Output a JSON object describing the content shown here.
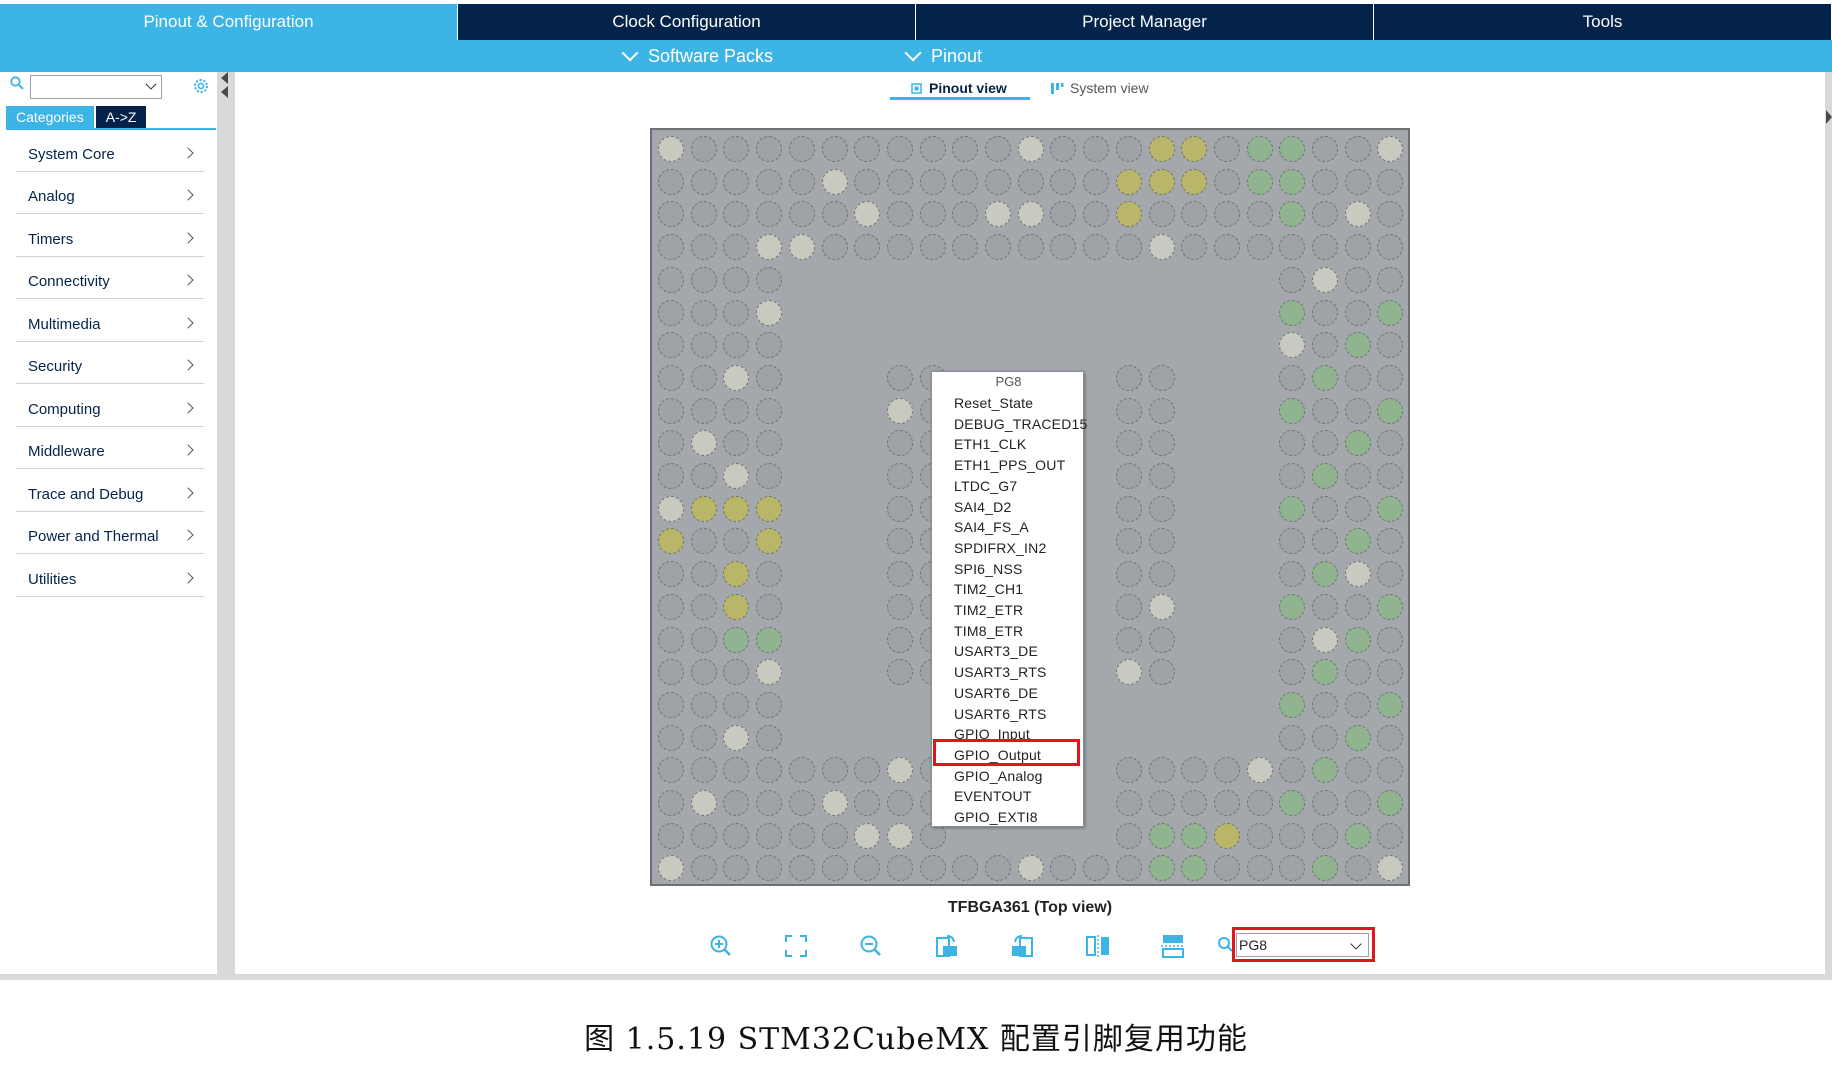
{
  "tabs": [
    {
      "label": "Pinout & Configuration",
      "active": true
    },
    {
      "label": "Clock Configuration",
      "active": false
    },
    {
      "label": "Project Manager",
      "active": false
    },
    {
      "label": "Tools",
      "active": false
    }
  ],
  "subbar": {
    "software_packs": "Software Packs",
    "pinout": "Pinout"
  },
  "sidebar": {
    "search_value": "",
    "cat_tab_categories": "Categories",
    "cat_tab_az": "A->Z",
    "items": [
      {
        "label": "System Core"
      },
      {
        "label": "Analog"
      },
      {
        "label": "Timers"
      },
      {
        "label": "Connectivity"
      },
      {
        "label": "Multimedia"
      },
      {
        "label": "Security"
      },
      {
        "label": "Computing"
      },
      {
        "label": "Middleware"
      },
      {
        "label": "Trace and Debug"
      },
      {
        "label": "Power and Thermal"
      },
      {
        "label": "Utilities"
      }
    ]
  },
  "views": {
    "pinout_view": "Pinout view",
    "system_view": "System view"
  },
  "chip": {
    "package_label": "TFBGA361 (Top view)"
  },
  "pin_menu": {
    "pin_name": "PG8",
    "items": [
      "Reset_State",
      "DEBUG_TRACED15",
      "ETH1_CLK",
      "ETH1_PPS_OUT",
      "LTDC_G7",
      "SAI4_D2",
      "SAI4_FS_A",
      "SPDIFRX_IN2",
      "SPI6_NSS",
      "TIM2_CH1",
      "TIM2_ETR",
      "TIM8_ETR",
      "USART3_DE",
      "USART3_RTS",
      "USART6_DE",
      "USART6_RTS",
      "GPIO_Input",
      "GPIO_Output",
      "GPIO_Analog",
      "EVENTOUT",
      "GPIO_EXTI8"
    ],
    "highlighted": "GPIO_Output"
  },
  "toolbar": {
    "pin_search_value": "PG8"
  },
  "caption": "图 1.5.19 STM32CubeMX 配置引脚复用功能",
  "colors": {
    "accent": "#3cb4e6",
    "dark": "#03234b",
    "highlight": "#e2141c",
    "chip": "#a4a8ad"
  }
}
